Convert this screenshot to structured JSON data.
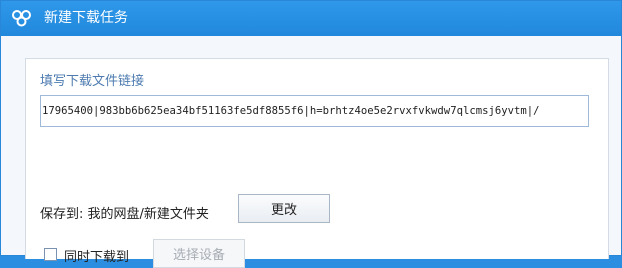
{
  "window": {
    "title": "新建下载任务",
    "logo_icon": "cloud-logo-icon",
    "titlebar_color": "#2188dc"
  },
  "form": {
    "link_label": "填写下载文件链接",
    "link_value": "17965400|983bb6b625ea34bf51163fe5df8855f6|h=brhtz4oe5e2rvxfvkwdw7qlcmsj6yvtm|/",
    "save_to_label": "保存到: 我的网盘/新建文件夹",
    "change_button": "更改",
    "download_to_label": "同时下载到",
    "download_to_checked": false,
    "select_device_button": "选择设备"
  }
}
